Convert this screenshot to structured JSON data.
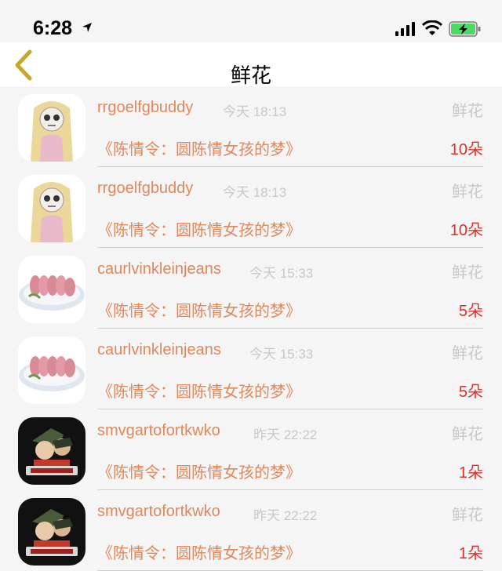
{
  "status_bar": {
    "time": "6:28"
  },
  "nav": {
    "title": "鲜花"
  },
  "items": [
    {
      "avatar": "avatar-blonde-girl",
      "user": "rrgoelfgbuddy",
      "time": "今天 18:13",
      "type": "鲜花",
      "book": "《陈情令：圆陈情女孩的梦》",
      "count": "10朵"
    },
    {
      "avatar": "avatar-blonde-girl",
      "user": "rrgoelfgbuddy",
      "time": "今天 18:13",
      "type": "鲜花",
      "book": "《陈情令：圆陈情女孩的梦》",
      "count": "10朵"
    },
    {
      "avatar": "avatar-sashimi",
      "user": "caurlvinkleinjeans",
      "time": "今天 15:33",
      "type": "鲜花",
      "book": "《陈情令：圆陈情女孩的梦》",
      "count": "5朵"
    },
    {
      "avatar": "avatar-sashimi",
      "user": "caurlvinkleinjeans",
      "time": "今天 15:33",
      "type": "鲜花",
      "book": "《陈情令：圆陈情女孩的梦》",
      "count": "5朵"
    },
    {
      "avatar": "avatar-detective",
      "user": "smvgartofortkwko",
      "time": "昨天 22:22",
      "type": "鲜花",
      "book": "《陈情令：圆陈情女孩的梦》",
      "count": "1朵"
    },
    {
      "avatar": "avatar-detective",
      "user": "smvgartofortkwko",
      "time": "昨天 22:22",
      "type": "鲜花",
      "book": "《陈情令：圆陈情女孩的梦》",
      "count": "1朵"
    }
  ],
  "colors": {
    "accent": "#e0885b",
    "count": "#e0302c",
    "muted": "#c8c8c8",
    "back": "#c8a82a"
  }
}
